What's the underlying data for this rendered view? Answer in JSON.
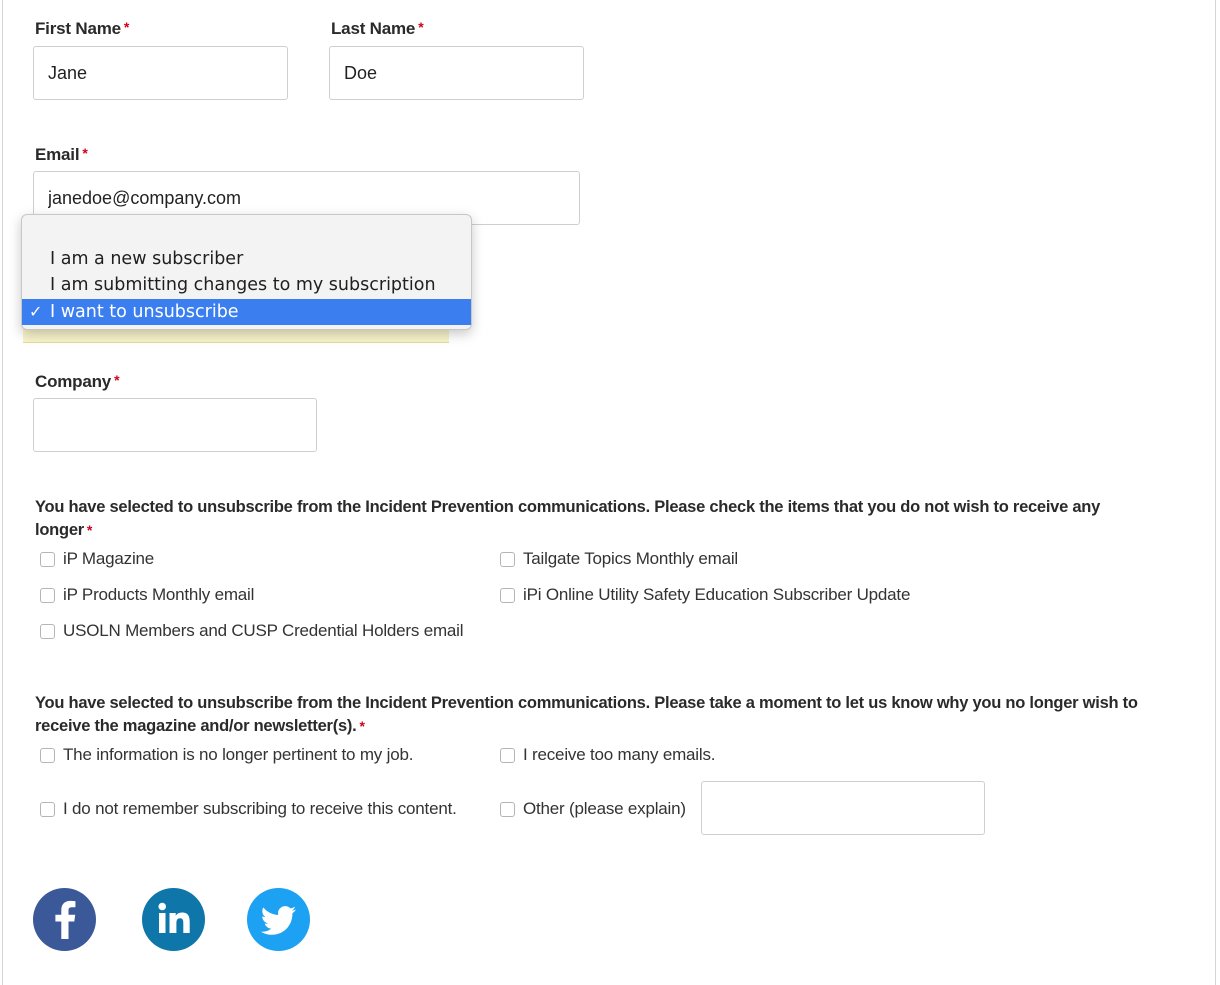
{
  "form": {
    "first_name": {
      "label": "First Name",
      "required_mark": "*",
      "value": "Jane"
    },
    "last_name": {
      "label": "Last Name",
      "required_mark": "*",
      "value": "Doe"
    },
    "email": {
      "label": "Email",
      "required_mark": "*",
      "value": "janedoe@company.com"
    },
    "subscription_status": {
      "options": [
        "I am a new subscriber",
        "I am submitting changes to my subscription",
        "I want to unsubscribe"
      ],
      "selected_index": 2,
      "check_mark": "✓"
    },
    "company": {
      "label": "Company",
      "required_mark": "*",
      "value": ""
    }
  },
  "unsubscribe_items": {
    "question_line1": "You have selected to unsubscribe from the Incident Prevention communications. Please check the items that you do not wish to receive any",
    "question_line2": "longer",
    "required_mark": "*",
    "items": [
      "iP Magazine",
      "Tailgate Topics Monthly email",
      "iP Products Monthly email",
      "iPi Online Utility Safety Education Subscriber Update",
      "USOLN Members and CUSP Credential Holders email"
    ]
  },
  "unsubscribe_reasons": {
    "question_line1": "You have selected to unsubscribe from the Incident Prevention communications. Please take a moment to let us know why you no longer wish to",
    "question_line2": "receive the magazine and/or newsletter(s).",
    "required_mark": "*",
    "items": [
      "The information is no longer pertinent to my job.",
      "I receive too many emails.",
      "I do not remember subscribing to receive this content.",
      "Other (please explain)"
    ],
    "other_value": ""
  },
  "social": {
    "icons": [
      "facebook-icon",
      "linkedin-icon",
      "twitter-icon"
    ],
    "colors": {
      "facebook": "#3b5998",
      "linkedin": "#0e76a8",
      "twitter": "#1da1f2"
    }
  },
  "colors": {
    "required": "#d0021b",
    "selected_option": "#3b7ef0",
    "highlight": "#f8f3c9"
  }
}
